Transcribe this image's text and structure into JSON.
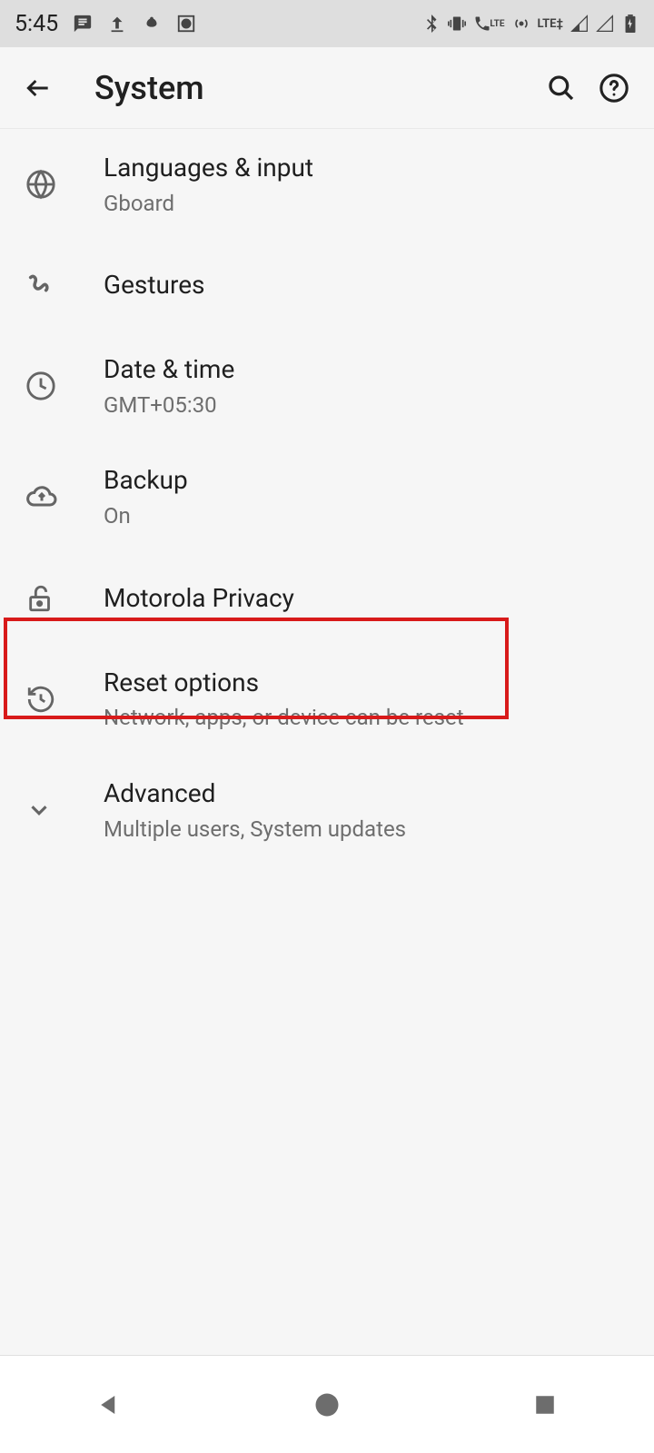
{
  "status": {
    "time": "5:45",
    "lte1": "LTE",
    "lte2": "LTE‡"
  },
  "header": {
    "title": "System"
  },
  "items": {
    "languages": {
      "title": "Languages & input",
      "subtitle": "Gboard"
    },
    "gestures": {
      "title": "Gestures"
    },
    "datetime": {
      "title": "Date & time",
      "subtitle": "GMT+05:30"
    },
    "backup": {
      "title": "Backup",
      "subtitle": "On"
    },
    "privacy": {
      "title": "Motorola Privacy"
    },
    "reset": {
      "title": "Reset options",
      "subtitle": "Network, apps, or device can be reset"
    },
    "advanced": {
      "title": "Advanced",
      "subtitle": "Multiple users, System updates"
    }
  }
}
